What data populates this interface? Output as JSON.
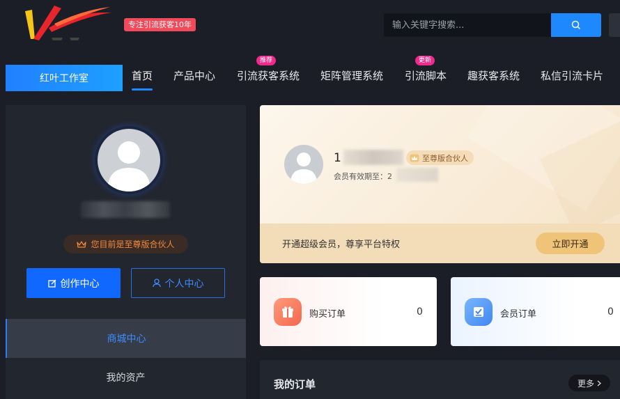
{
  "header": {
    "slogan": "专注引流获客10年",
    "search_placeholder": "输入关键字搜索..."
  },
  "nav": {
    "studio": "红叶工作室",
    "items": [
      {
        "label": "首页",
        "badge": ""
      },
      {
        "label": "产品中心",
        "badge": ""
      },
      {
        "label": "引流获客系统",
        "badge": "推荐"
      },
      {
        "label": "矩阵管理系统",
        "badge": ""
      },
      {
        "label": "引流脚本",
        "badge": "更新"
      },
      {
        "label": "趣获客系统",
        "badge": ""
      },
      {
        "label": "私信引流卡片",
        "badge": ""
      }
    ]
  },
  "sidebar": {
    "vip_text": "您目前是至尊版合伙人",
    "create_btn": "创作中心",
    "personal_btn": "个人中心",
    "menu": [
      "商城中心",
      "我的资产"
    ]
  },
  "member_card": {
    "name_prefix": "1",
    "badge": "至尊版合伙人",
    "expire_label": "会员有效期至：2",
    "promo": "开通超级会员，尊享平台特权",
    "open_btn": "立即开通"
  },
  "orders": {
    "buy": {
      "label": "购买订单",
      "count": "0"
    },
    "member": {
      "label": "会员订单",
      "count": "0"
    }
  },
  "my_orders": {
    "title": "我的订单",
    "more": "更多"
  },
  "colors": {
    "accent": "#1e89ff",
    "badge_pink": "#ee2a8c",
    "slogan_red": "#f04a5b",
    "vip_orange": "#f0893f",
    "gold": "#f0c478"
  }
}
